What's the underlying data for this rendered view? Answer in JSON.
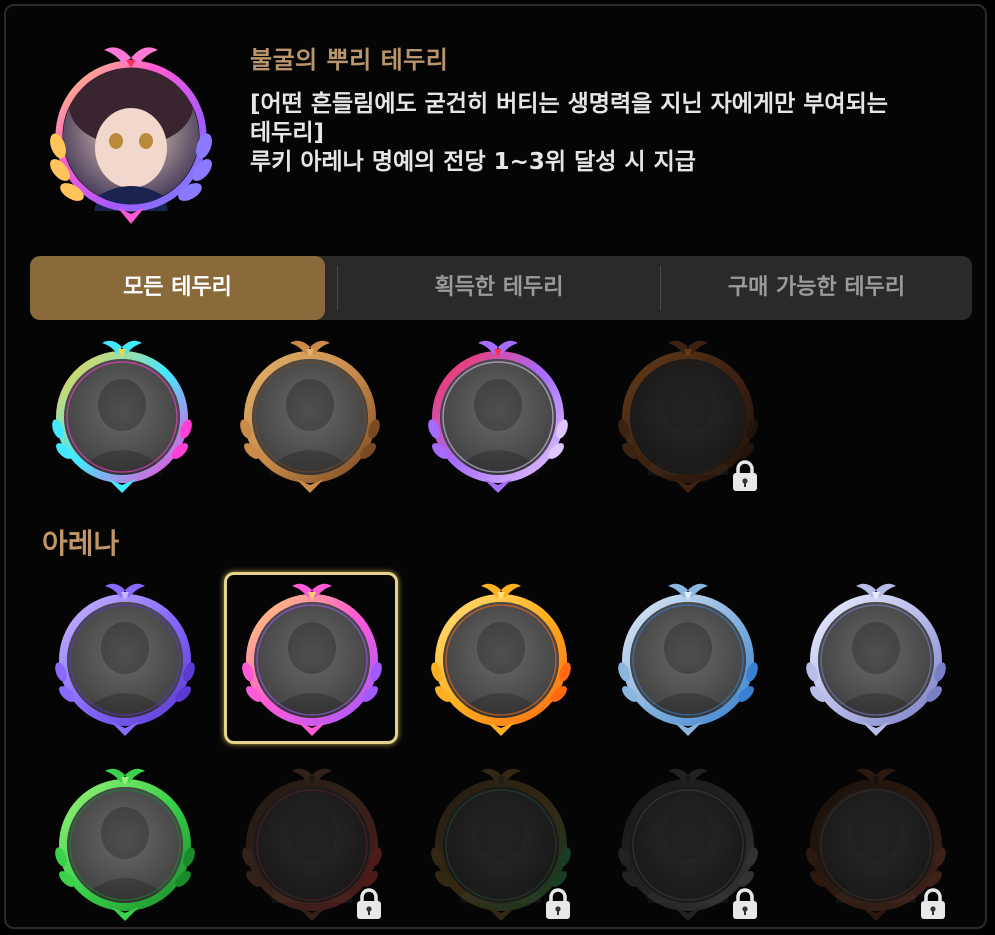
{
  "header": {
    "selected_frame_name": "불굴의 뿌리 테두리",
    "description_lines": [
      "[어떤 흔들림에도 굳건히 버티는 생명력을 지닌 자에게만 부여되는",
      "테두리]",
      "루키 아레나 명예의 전당 1~3위 달성 시 지급"
    ]
  },
  "tabs": [
    {
      "label": "모든 테두리",
      "active": true
    },
    {
      "label": "획득한 테두리",
      "active": false
    },
    {
      "label": "구매 가능한 테두리",
      "active": false
    }
  ],
  "top_frames": [
    {
      "name": "glitch",
      "colors": [
        "#43e8ff",
        "#ff3fd6",
        "#ffd23f"
      ],
      "locked": false
    },
    {
      "name": "steampunk",
      "colors": [
        "#c98a4a",
        "#7a4a22",
        "#e2b26a"
      ],
      "locked": false
    },
    {
      "name": "crystal-spike",
      "colors": [
        "#a66bff",
        "#e0c6ff",
        "#ff3050"
      ],
      "locked": false
    },
    {
      "name": "flame-dark",
      "colors": [
        "#6a3a1a",
        "#3a2010",
        "#b06a2a"
      ],
      "locked": true
    }
  ],
  "arena_section": {
    "title": "아레나",
    "frames": [
      {
        "name": "arena-violet",
        "colors": [
          "#8a6bff",
          "#5a3ad0",
          "#c8b8ff"
        ],
        "locked": false,
        "selected": false
      },
      {
        "name": "arena-rainbow-laurel",
        "colors": [
          "#ff5ad6",
          "#a25aff",
          "#ffd06a"
        ],
        "locked": false,
        "selected": true
      },
      {
        "name": "arena-gold-laurel",
        "colors": [
          "#ffb020",
          "#ff6a10",
          "#ffe07a"
        ],
        "locked": false,
        "selected": false
      },
      {
        "name": "arena-silver-laurel",
        "colors": [
          "#8ab6e0",
          "#3a80d0",
          "#dfe8f5"
        ],
        "locked": false,
        "selected": false
      },
      {
        "name": "arena-silver-ring",
        "colors": [
          "#b8bce8",
          "#7a80c8",
          "#e8ecff"
        ],
        "locked": false,
        "selected": false
      },
      {
        "name": "arena-green",
        "colors": [
          "#3ad24a",
          "#1a8a2a",
          "#9af07a"
        ],
        "locked": false,
        "selected": false
      },
      {
        "name": "arena-ruby-laurel",
        "colors": [
          "#5a3a2a",
          "#8a2a2a",
          "#3a2a20"
        ],
        "locked": true,
        "selected": false
      },
      {
        "name": "arena-emerald-laurel",
        "colors": [
          "#5a4520",
          "#2a6a3a",
          "#3a3020"
        ],
        "locked": true,
        "selected": false
      },
      {
        "name": "arena-steel",
        "colors": [
          "#3a3a3a",
          "#5a5a5a",
          "#2a2a2a"
        ],
        "locked": true,
        "selected": false
      },
      {
        "name": "arena-bronze-ring",
        "colors": [
          "#4a2a1a",
          "#6a3a2a",
          "#2a1a10"
        ],
        "locked": true,
        "selected": false
      }
    ]
  }
}
